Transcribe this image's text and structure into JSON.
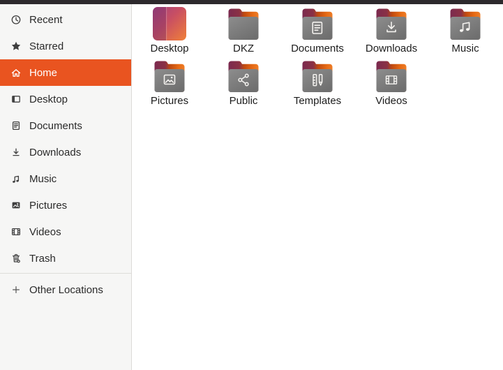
{
  "colors": {
    "accent": "#e95420",
    "topbar": "#2d292d",
    "sidebar_bg": "#f6f6f5",
    "folder_body_gray": "#7d7d7d",
    "folder_tab_maroon": "#7b2a4f",
    "folder_tab_orange": "#e8701f",
    "desktop_tile_purple": "#a2417f",
    "desktop_tile_orange": "#f08038"
  },
  "sidebar": {
    "items": [
      {
        "label": "Recent",
        "icon": "clock-icon",
        "selected": false
      },
      {
        "label": "Starred",
        "icon": "star-icon",
        "selected": false
      },
      {
        "label": "Home",
        "icon": "home-icon",
        "selected": true
      },
      {
        "label": "Desktop",
        "icon": "desktop-icon",
        "selected": false
      },
      {
        "label": "Documents",
        "icon": "document-icon",
        "selected": false
      },
      {
        "label": "Downloads",
        "icon": "download-icon",
        "selected": false
      },
      {
        "label": "Music",
        "icon": "music-note-icon",
        "selected": false
      },
      {
        "label": "Pictures",
        "icon": "picture-icon",
        "selected": false
      },
      {
        "label": "Videos",
        "icon": "film-icon",
        "selected": false
      },
      {
        "label": "Trash",
        "icon": "trash-icon",
        "selected": false
      }
    ],
    "other_locations": {
      "label": "Other Locations",
      "icon": "plus-icon"
    }
  },
  "files": {
    "items": [
      {
        "name": "Desktop",
        "icon": "desktop-gradient-tile-icon"
      },
      {
        "name": "DKZ",
        "icon": "folder-icon"
      },
      {
        "name": "Documents",
        "icon": "folder-documents-icon"
      },
      {
        "name": "Downloads",
        "icon": "folder-downloads-icon"
      },
      {
        "name": "Music",
        "icon": "folder-music-icon"
      },
      {
        "name": "Pictures",
        "icon": "folder-pictures-icon"
      },
      {
        "name": "Public",
        "icon": "folder-public-share-icon"
      },
      {
        "name": "Templates",
        "icon": "folder-templates-icon"
      },
      {
        "name": "Videos",
        "icon": "folder-videos-icon"
      }
    ]
  }
}
